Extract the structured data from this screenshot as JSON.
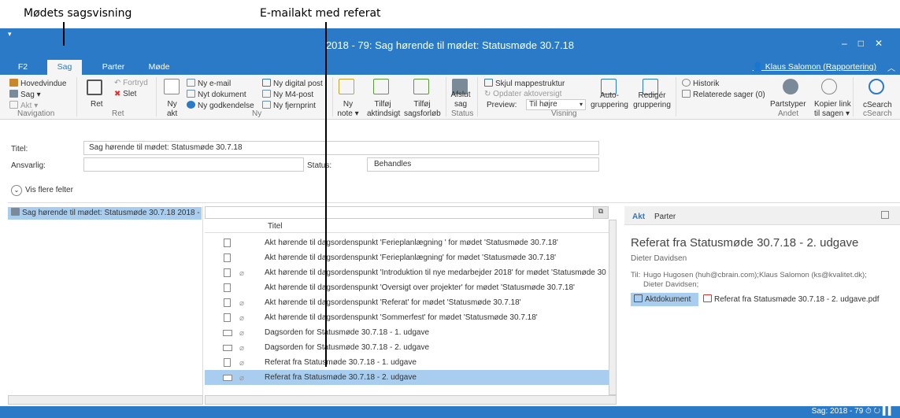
{
  "annotations": {
    "a1": "Mødets sagsvisning",
    "a2": "E-mailakt med referat"
  },
  "window": {
    "title": "2018 - 79: Sag hørende til mødet: Statusmøde 30.7.18",
    "user": "Klaus Salomon (Rapportering)"
  },
  "tabs": [
    "F2",
    "Sag",
    "Parter",
    "Møde"
  ],
  "ribbon": {
    "nav": {
      "hovedvindue": "Hovedvindue",
      "sag": "Sag ▾",
      "akt": "Akt ▾",
      "group": "Navigation"
    },
    "ret": {
      "ret": "Ret",
      "fortryd": "Fortryd",
      "slet": "Slet",
      "group": "Ret"
    },
    "ny": {
      "nyakt1": "Ny",
      "nyakt2": "akt",
      "email": "Ny e-mail",
      "dok": "Nyt dokument",
      "godk": "Ny godkendelse",
      "digital": "Ny digital post",
      "m4": "Ny M4-post",
      "fjern": "Ny fjernprint",
      "group": "Ny"
    },
    "note": {
      "n1": "Ny",
      "n2": "note ▾",
      "t1": "Tilføj",
      "t2": "aktindsigt",
      "s1": "Tilføj",
      "s2": "sagsforløb"
    },
    "status": {
      "a1": "Afslut",
      "a2": "sag",
      "group": "Status"
    },
    "visning": {
      "skjul": "Skjul mappestruktur",
      "opd": "Opdater aktoversigt",
      "preview": "Preview:",
      "preview_val": "Til højre",
      "auto1": "Auto-",
      "auto2": "gruppering",
      "red1": "Redigér",
      "red2": "gruppering",
      "group": "Visning"
    },
    "andet": {
      "hist": "Historik",
      "rel": "Relaterede sager (0)",
      "parts": "Partstyper",
      "kop1": "Kopier link",
      "kop2": "til sagen ▾",
      "group": "Andet"
    },
    "csearch": {
      "label": "cSearch",
      "group": "cSearch"
    }
  },
  "fields": {
    "titel_lbl": "Titel:",
    "titel": "Sag hørende til mødet: Statusmøde 30.7.18",
    "ansv_lbl": "Ansvarlig:",
    "status_lbl": "Status:",
    "status": "Behandles",
    "flere": "Vis flere felter"
  },
  "tree": {
    "item": "Sag hørende til mødet: Statusmøde 30.7.18 2018 -"
  },
  "list": {
    "header": "Titel",
    "rows": [
      {
        "t": "Akt hørende til dagsordenspunkt 'Ferieplanlægning ' for mødet 'Statusmøde 30.7.18'",
        "k": "doc",
        "c": false
      },
      {
        "t": "Akt hørende til dagsordenspunkt 'Ferieplanlægning' for mødet 'Statusmøde 30.7.18'",
        "k": "doc",
        "c": false
      },
      {
        "t": "Akt hørende til dagsordenspunkt 'Introduktion til nye medarbejder 2018' for mødet 'Statusmøde 30",
        "k": "doc",
        "c": true
      },
      {
        "t": "Akt hørende til dagsordenspunkt 'Oversigt over projekter' for mødet 'Statusmøde 30.7.18'",
        "k": "doc",
        "c": false
      },
      {
        "t": "Akt hørende til dagsordenspunkt 'Referat' for mødet 'Statusmøde 30.7.18'",
        "k": "doc",
        "c": true
      },
      {
        "t": "Akt hørende til dagsordenspunkt 'Sommerfest' for mødet 'Statusmøde 30.7.18'",
        "k": "doc",
        "c": true
      },
      {
        "t": "Dagsorden for Statusmøde 30.7.18 - 1. udgave",
        "k": "mail",
        "c": true
      },
      {
        "t": "Dagsorden for Statusmøde 30.7.18 - 2. udgave",
        "k": "mail",
        "c": true
      },
      {
        "t": "Referat fra Statusmøde 30.7.18 - 1. udgave",
        "k": "doc",
        "c": true
      },
      {
        "t": "Referat fra Statusmøde 30.7.18 - 2. udgave",
        "k": "mail",
        "c": true,
        "sel": true
      }
    ]
  },
  "preview": {
    "tab1": "Akt",
    "tab2": "Parter",
    "title": "Referat fra Statusmøde 30.7.18 - 2. udgave",
    "from": "Dieter Davidsen",
    "til_lbl": "Til:",
    "til1": "Hugo Hugosen (huh@cbrain.com);Klaus Salomon (ks@kvalitet.dk);",
    "til2": "Dieter Davidsen;",
    "aktdok": "Aktdokument",
    "file": "Referat fra Statusmøde 30.7.18 - 2. udgave.pdf"
  },
  "statusbar": {
    "text": "Sag: 2018 - 79 ⏱ ↻ ▌▌"
  },
  "colors": {
    "accent": "#2b7ac7",
    "selected": "#a8cdee"
  }
}
